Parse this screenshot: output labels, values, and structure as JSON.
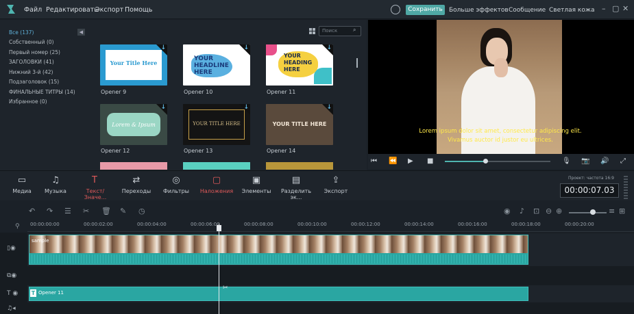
{
  "menubar": {
    "items": [
      "Файл",
      "Редактировать",
      "Экспорт",
      "Помощь"
    ]
  },
  "header": {
    "save_label": "Сохранить",
    "right_items": [
      "Больше эффектов",
      "Сообщение",
      "Светлая кожа"
    ]
  },
  "library": {
    "categories": [
      "Все (137)",
      "Собственный (0)",
      "Первый номер (25)",
      "ЗАГОЛОВКИ (41)",
      "Нижний 3-й (42)",
      "Подзаголовок (15)",
      "ФИНАЛЬНЫЕ ТИТРЫ (14)",
      "Избранное (0)"
    ],
    "search_placeholder": "Поиск",
    "thumbs": [
      {
        "label": "Opener 9",
        "text": "Your Title Here",
        "bg": "#2a9ad0"
      },
      {
        "label": "Opener 10",
        "text": "YOUR HEADLINE HERE",
        "bg": "#ffffff"
      },
      {
        "label": "Opener 11",
        "text": "YOUR HEADING HERE",
        "bg": "#ffffff"
      },
      {
        "label": "Opener 12",
        "text": "Lorem & Ipsum",
        "bg": "#3a4a45"
      },
      {
        "label": "Opener 13",
        "text": "YOUR TITLE HERE",
        "bg": "#141414"
      },
      {
        "label": "Opener 14",
        "text": "YOUR TITLE HERE",
        "bg": "#5a4a3c"
      }
    ]
  },
  "preview": {
    "subtitle_line1": "Lorem ipsum dolor sit amet, consectetur adipiscing elit.",
    "subtitle_line2": "Vivamus auctor id justor eu ultrices.",
    "progress": 0.38
  },
  "toolbar": {
    "items": [
      "Медиа",
      "Музыка",
      "Текст/Значе...",
      "Переходы",
      "Фильтры",
      "Наложения",
      "Элементы",
      "Разделить эк...",
      "Экспорт"
    ],
    "timecode_label": "Проект: частота 16:9",
    "timecode": "00:00:07.03"
  },
  "timeline": {
    "ticks": [
      "00:00:00:00",
      "00:00:02:00",
      "00:00:04:00",
      "00:00:06:00",
      "00:00:08:00",
      "00:00:10:00",
      "00:00:12:00",
      "00:00:14:00",
      "00:00:16:00",
      "00:00:18:00",
      "00:00:20:00"
    ],
    "video_clip": "sample",
    "text_clip": "Opener 11"
  },
  "colors": {
    "accent": "#4fa8a5",
    "active": "#e05a5a"
  }
}
